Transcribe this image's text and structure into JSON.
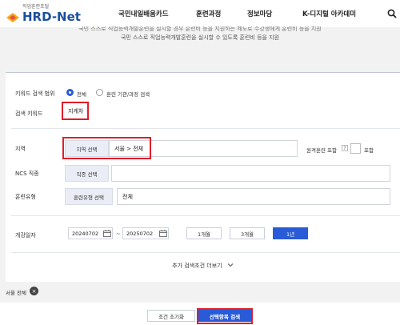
{
  "header": {
    "logo_sub": "직업훈련포털",
    "logo_text": "HRD-Net",
    "nav": [
      "국민내일배움카드",
      "훈련과정",
      "정보마당",
      "K-디지털 아카데미"
    ]
  },
  "intro": {
    "line1": "국민 스스로 직업능력개발훈련을 실시할 경우 훈련비 등을 지원하는 제도로 수강생에게 훈련비 등을 지원",
    "line2": "국민 스스로 직업능력개발훈련을 실시할 수 있도록 훈련비 등을 지원"
  },
  "form": {
    "keyword_scope_label": "키워드 검색 범위",
    "scope_options": [
      "전체",
      "훈련 기관/과정 검색"
    ],
    "keyword_label": "검색 키워드",
    "keyword_value": "지게차",
    "region_label": "지역",
    "region_button": "지역 선택",
    "region_value": "서울 > 전체",
    "remote_label": "원격훈련 포함",
    "remote_help": "?",
    "include_label": "포함",
    "ncs_label": "NCS 직종",
    "ncs_button": "직종 선택",
    "type_label": "훈련유형",
    "type_button": "훈련유형 선택",
    "type_value": "전체",
    "date_label": "개강일자",
    "date_from": "20240702",
    "date_sep": "~",
    "date_to": "20250702",
    "periods": [
      "1개월",
      "3개월",
      "1년"
    ],
    "more_label": "추가 검색조건 더보기"
  },
  "filters": {
    "chip_label": "서울 전체",
    "chip_remove": "×"
  },
  "actions": {
    "reset_label": "조건 초기화",
    "apply_label": "선택항목 검색"
  },
  "colors": {
    "accent": "#2a5bd7",
    "highlight": "#e11d2a",
    "brand": "#1c4fa0"
  }
}
